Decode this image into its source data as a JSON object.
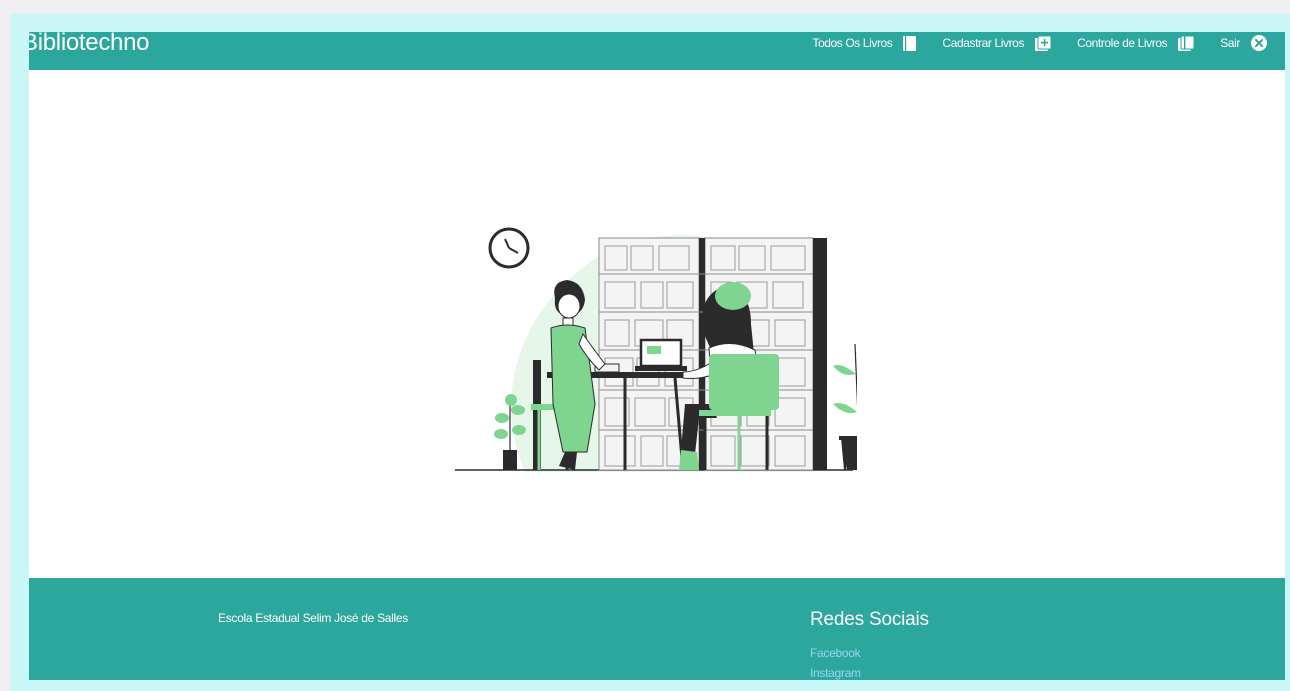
{
  "brand": {
    "name": "Bibliotechno"
  },
  "nav": {
    "items": [
      {
        "label": "Todos Os Livros",
        "icon": "book-icon"
      },
      {
        "label": "Cadastrar Livros",
        "icon": "add-book-icon"
      },
      {
        "label": "Controle de Livros",
        "icon": "books-icon"
      },
      {
        "label": "Sair",
        "icon": "close-circle-icon"
      }
    ]
  },
  "hero": {
    "illustration": "library-reading-illustration"
  },
  "footer": {
    "school": "Escola Estadual Selim José de Salles",
    "social_title": "Redes Sociais",
    "links": [
      "Facebook",
      "Instagram"
    ]
  },
  "colors": {
    "primary": "#2ba79d",
    "accent_green": "#7fd58f",
    "link": "#9bd3f5",
    "frame": "#c9f6f7"
  }
}
